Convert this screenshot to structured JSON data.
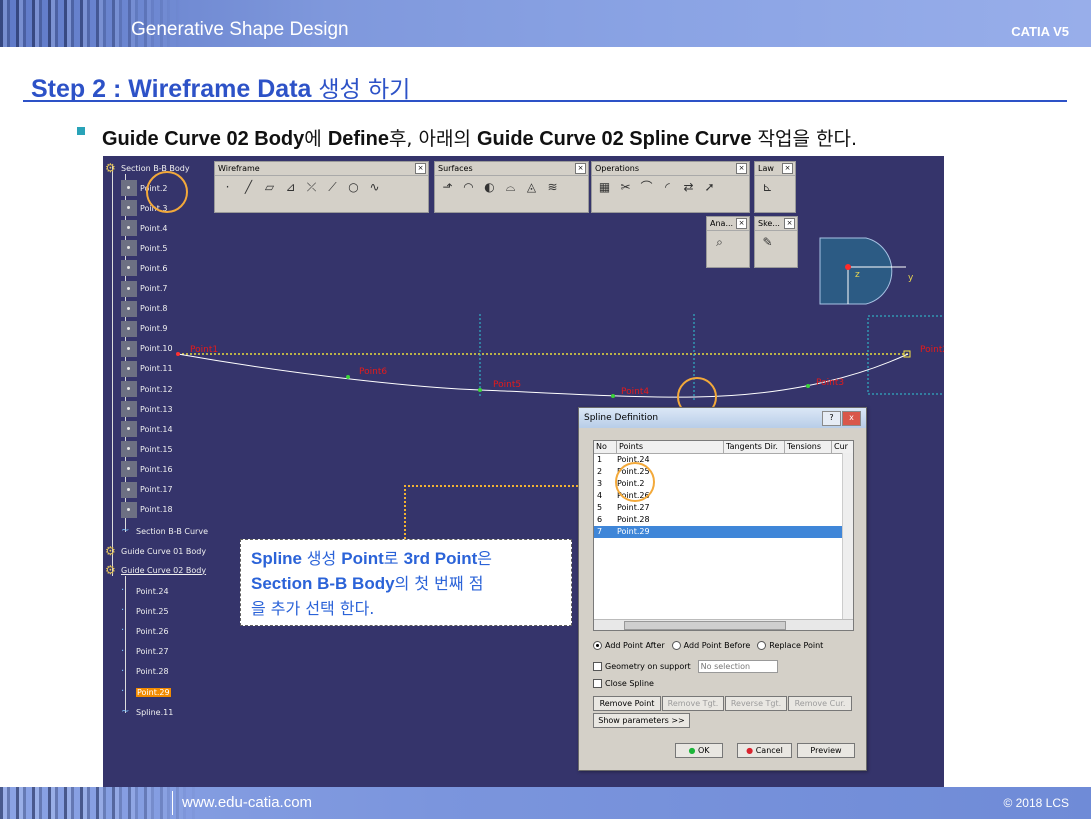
{
  "header": {
    "title": "Generative Shape Design",
    "brand": "CATIA V5"
  },
  "step": {
    "prefix": "Step 2 : Wireframe Data ",
    "korean": "생성 하기"
  },
  "instruction": {
    "p1": "Guide Curve 02 Body",
    "k1": "에 ",
    "p2": "Define",
    "k2": "후, 아래의 ",
    "p3": "Guide Curve 02 Spline Curve",
    "k3": " 작업을 한다."
  },
  "tree": {
    "section_body": "Section B-B Body",
    "points": [
      "Point.2",
      "Point.3",
      "Point.4",
      "Point.5",
      "Point.6",
      "Point.7",
      "Point.8",
      "Point.9",
      "Point.10",
      "Point.11",
      "Point.12",
      "Point.13",
      "Point.14",
      "Point.15",
      "Point.16",
      "Point.17",
      "Point.18"
    ],
    "section_curve": "Section B-B Curve",
    "guide01": "Guide Curve 01 Body",
    "guide02": "Guide Curve 02 Body",
    "guide02_points": [
      "Point.24",
      "Point.25",
      "Point.26",
      "Point.27",
      "Point.28",
      "Point.29"
    ],
    "spline": "Spline.11"
  },
  "toolbars": {
    "wireframe": "Wireframe",
    "surfaces": "Surfaces",
    "operations": "Operations",
    "law": "Law",
    "analysis": "Ana...",
    "sketch": "Ske..."
  },
  "axis": {
    "z": "z",
    "y": "y"
  },
  "viewport_labels": [
    "Point1",
    "Point6",
    "Point5",
    "Point4",
    "Point3",
    "Point2",
    "Point"
  ],
  "callout": {
    "l1a": "Spline ",
    "l1b": "생성 ",
    "l1c": "Point",
    "l1d": "로 ",
    "l1e": "3rd Point",
    "l1f": "은",
    "l2a": "Section B-B Body",
    "l2b": "의 첫 번째 점",
    "l3": "을 추가 선택 한다."
  },
  "dialog": {
    "title": "Spline Definition",
    "help": "?",
    "close": "x",
    "columns": [
      "No",
      "Points",
      "Tangents Dir.",
      "Tensions",
      "Cur"
    ],
    "rows": [
      {
        "no": "1",
        "point": "Point.24"
      },
      {
        "no": "2",
        "point": "Point.25"
      },
      {
        "no": "3",
        "point": "Point.2"
      },
      {
        "no": "4",
        "point": "Point.26"
      },
      {
        "no": "5",
        "point": "Point.27"
      },
      {
        "no": "6",
        "point": "Point.28"
      },
      {
        "no": "7",
        "point": "Point.29"
      }
    ],
    "selected_row": 7,
    "add_after": "Add Point After",
    "add_before": "Add Point Before",
    "replace": "Replace Point",
    "geometry_support": "Geometry on support",
    "no_selection": "No selection",
    "close_spline": "Close Spline",
    "remove_point": "Remove Point",
    "remove_tgt": "Remove Tgt.",
    "reverse_tgt": "Reverse Tgt.",
    "remove_cur": "Remove Cur.",
    "show_params": "Show parameters >>",
    "ok": "OK",
    "cancel": "Cancel",
    "preview": "Preview"
  },
  "footer": {
    "url": "www.edu-catia.com",
    "copyright": "© 2018 LCS"
  }
}
